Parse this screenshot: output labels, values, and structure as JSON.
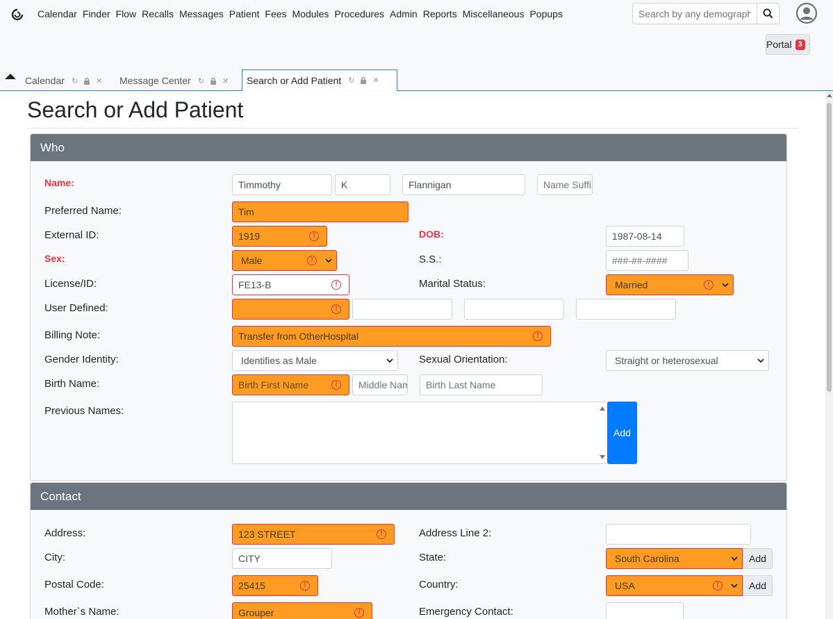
{
  "nav": {
    "menu": [
      "Calendar",
      "Finder",
      "Flow",
      "Recalls",
      "Messages",
      "Patient",
      "Fees",
      "Modules",
      "Procedures",
      "Admin",
      "Reports",
      "Miscellaneous",
      "Popups"
    ],
    "search_placeholder": "Search by any demographics",
    "portal_label": "Portal",
    "portal_count": "3"
  },
  "tabs": [
    {
      "label": "Calendar"
    },
    {
      "label": "Message Center"
    },
    {
      "label": "Search or Add Patient"
    }
  ],
  "page": {
    "title": "Search or Add Patient"
  },
  "who": {
    "header": "Who",
    "labels": {
      "name": "Name:",
      "preferred_name": "Preferred Name:",
      "external_id": "External ID:",
      "dob": "DOB:",
      "sex": "Sex:",
      "ss": "S.S.:",
      "license": "License/ID:",
      "marital": "Marital Status:",
      "user_defined": "User Defined:",
      "billing_note": "Billing Note:",
      "gender_identity": "Gender Identity:",
      "sexual_orientation": "Sexual Orientation:",
      "birth_name": "Birth Name:",
      "previous_names": "Previous Names:"
    },
    "values": {
      "first_name": "Timmothy",
      "middle_name": "K",
      "last_name": "Flannigan",
      "suffix_placeholder": "Name Suffix",
      "preferred_name": "Tim",
      "external_id": "1919",
      "dob": "1987-08-14",
      "sex": "Male",
      "ss_placeholder": "###-##-####",
      "license": "FE13-B",
      "marital": "Married",
      "billing_note": "Transfer from OtherHospital",
      "gender_identity": "Identifies as Male",
      "sexual_orientation": "Straight or heterosexual",
      "birth_first_placeholder": "Birth First Name",
      "birth_middle_placeholder": "Middle Name",
      "birth_last_placeholder": "Birth Last Name"
    },
    "add_label": "Add"
  },
  "contact": {
    "header": "Contact",
    "labels": {
      "address": "Address:",
      "address2": "Address Line 2:",
      "city": "City:",
      "state": "State:",
      "postal": "Postal Code:",
      "country": "Country:",
      "mother": "Mother`s Name:",
      "emergency": "Emergency Contact:"
    },
    "values": {
      "address": "123 STREET",
      "city": "CITY",
      "state": "South Carolina",
      "postal": "25415",
      "country": "USA",
      "mother": "Grouper"
    },
    "add_label": "Add"
  }
}
